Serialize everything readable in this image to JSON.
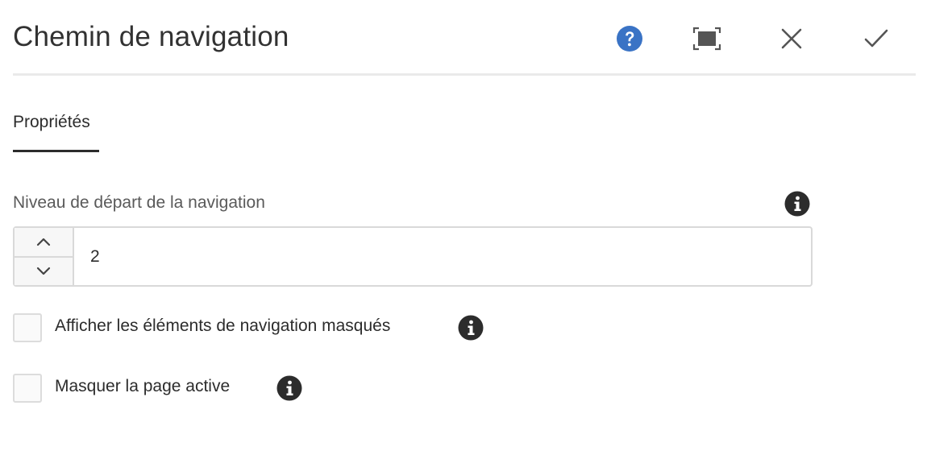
{
  "dialog": {
    "title": "Chemin de navigation",
    "actions": {
      "help_icon": "help-icon",
      "fullscreen_icon": "fullscreen-icon",
      "close_icon": "close-icon",
      "done_icon": "checkmark-icon"
    }
  },
  "tabs": [
    {
      "label": "Propriétés",
      "active": true
    }
  ],
  "fields": {
    "start_level": {
      "label": "Niveau de départ de la navigation",
      "value": "2"
    },
    "show_hidden": {
      "label": "Afficher les éléments de navigation masqués",
      "checked": false
    },
    "hide_current": {
      "label": "Masquer la page active",
      "checked": false
    }
  },
  "colors": {
    "help_blue": "#3a73c5",
    "info_dark": "#2c2c2c",
    "border": "#d9d9d9",
    "divider": "#eaeaea"
  }
}
